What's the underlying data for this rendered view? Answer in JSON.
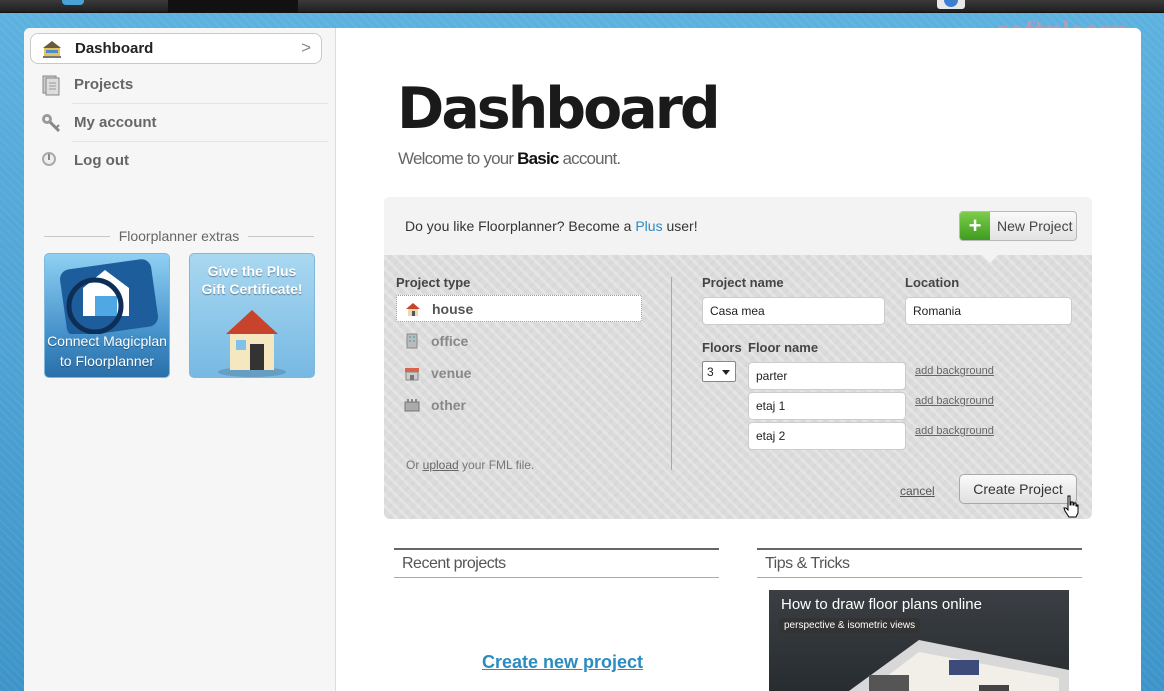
{
  "watermark": "softulescu",
  "sidebar": {
    "items": [
      {
        "label": "Dashboard",
        "icon": "dashboard-icon"
      },
      {
        "label": "Projects",
        "icon": "projects-icon"
      },
      {
        "label": "My account",
        "icon": "keys-icon"
      },
      {
        "label": "Log out",
        "icon": "power-icon"
      }
    ],
    "extras_title": "Floorplanner extras",
    "magicplan": {
      "line1": "Connect Magicplan",
      "line2": "to Floorplanner"
    },
    "gift": {
      "line1": "Give the Plus",
      "line2": "Gift Certificate!"
    }
  },
  "main": {
    "title": "Dashboard",
    "welcome_prefix": "Welcome to your ",
    "welcome_plan": "Basic",
    "welcome_suffix": " account."
  },
  "panel": {
    "promo_prefix": "Do you like Floorplanner? Become a ",
    "promo_link": "Plus",
    "promo_suffix": " user!",
    "new_project_label": "New Project",
    "project_type_label": "Project type",
    "project_types": [
      "house",
      "office",
      "venue",
      "other"
    ],
    "upload_prefix": "Or ",
    "upload_link": "upload",
    "upload_suffix": " your FML file.",
    "project_name_label": "Project name",
    "project_name_value": "Casa mea",
    "location_label": "Location",
    "location_value": "Romania",
    "floors_label": "Floors",
    "floors_value": "3",
    "floor_name_label": "Floor name",
    "floors": [
      "parter",
      "etaj 1",
      "etaj 2"
    ],
    "add_background": "add background",
    "cancel": "cancel",
    "create_label": "Create Project"
  },
  "recent": {
    "title": "Recent projects",
    "create_link": "Create new project"
  },
  "tips": {
    "title": "Tips & Tricks",
    "video_title": "How to draw floor plans online",
    "video_subtitle": "perspective & isometric views"
  },
  "colors": {
    "accent": "#2a8cc0",
    "green": "#5cb83a",
    "background": "#4aa3d6"
  }
}
